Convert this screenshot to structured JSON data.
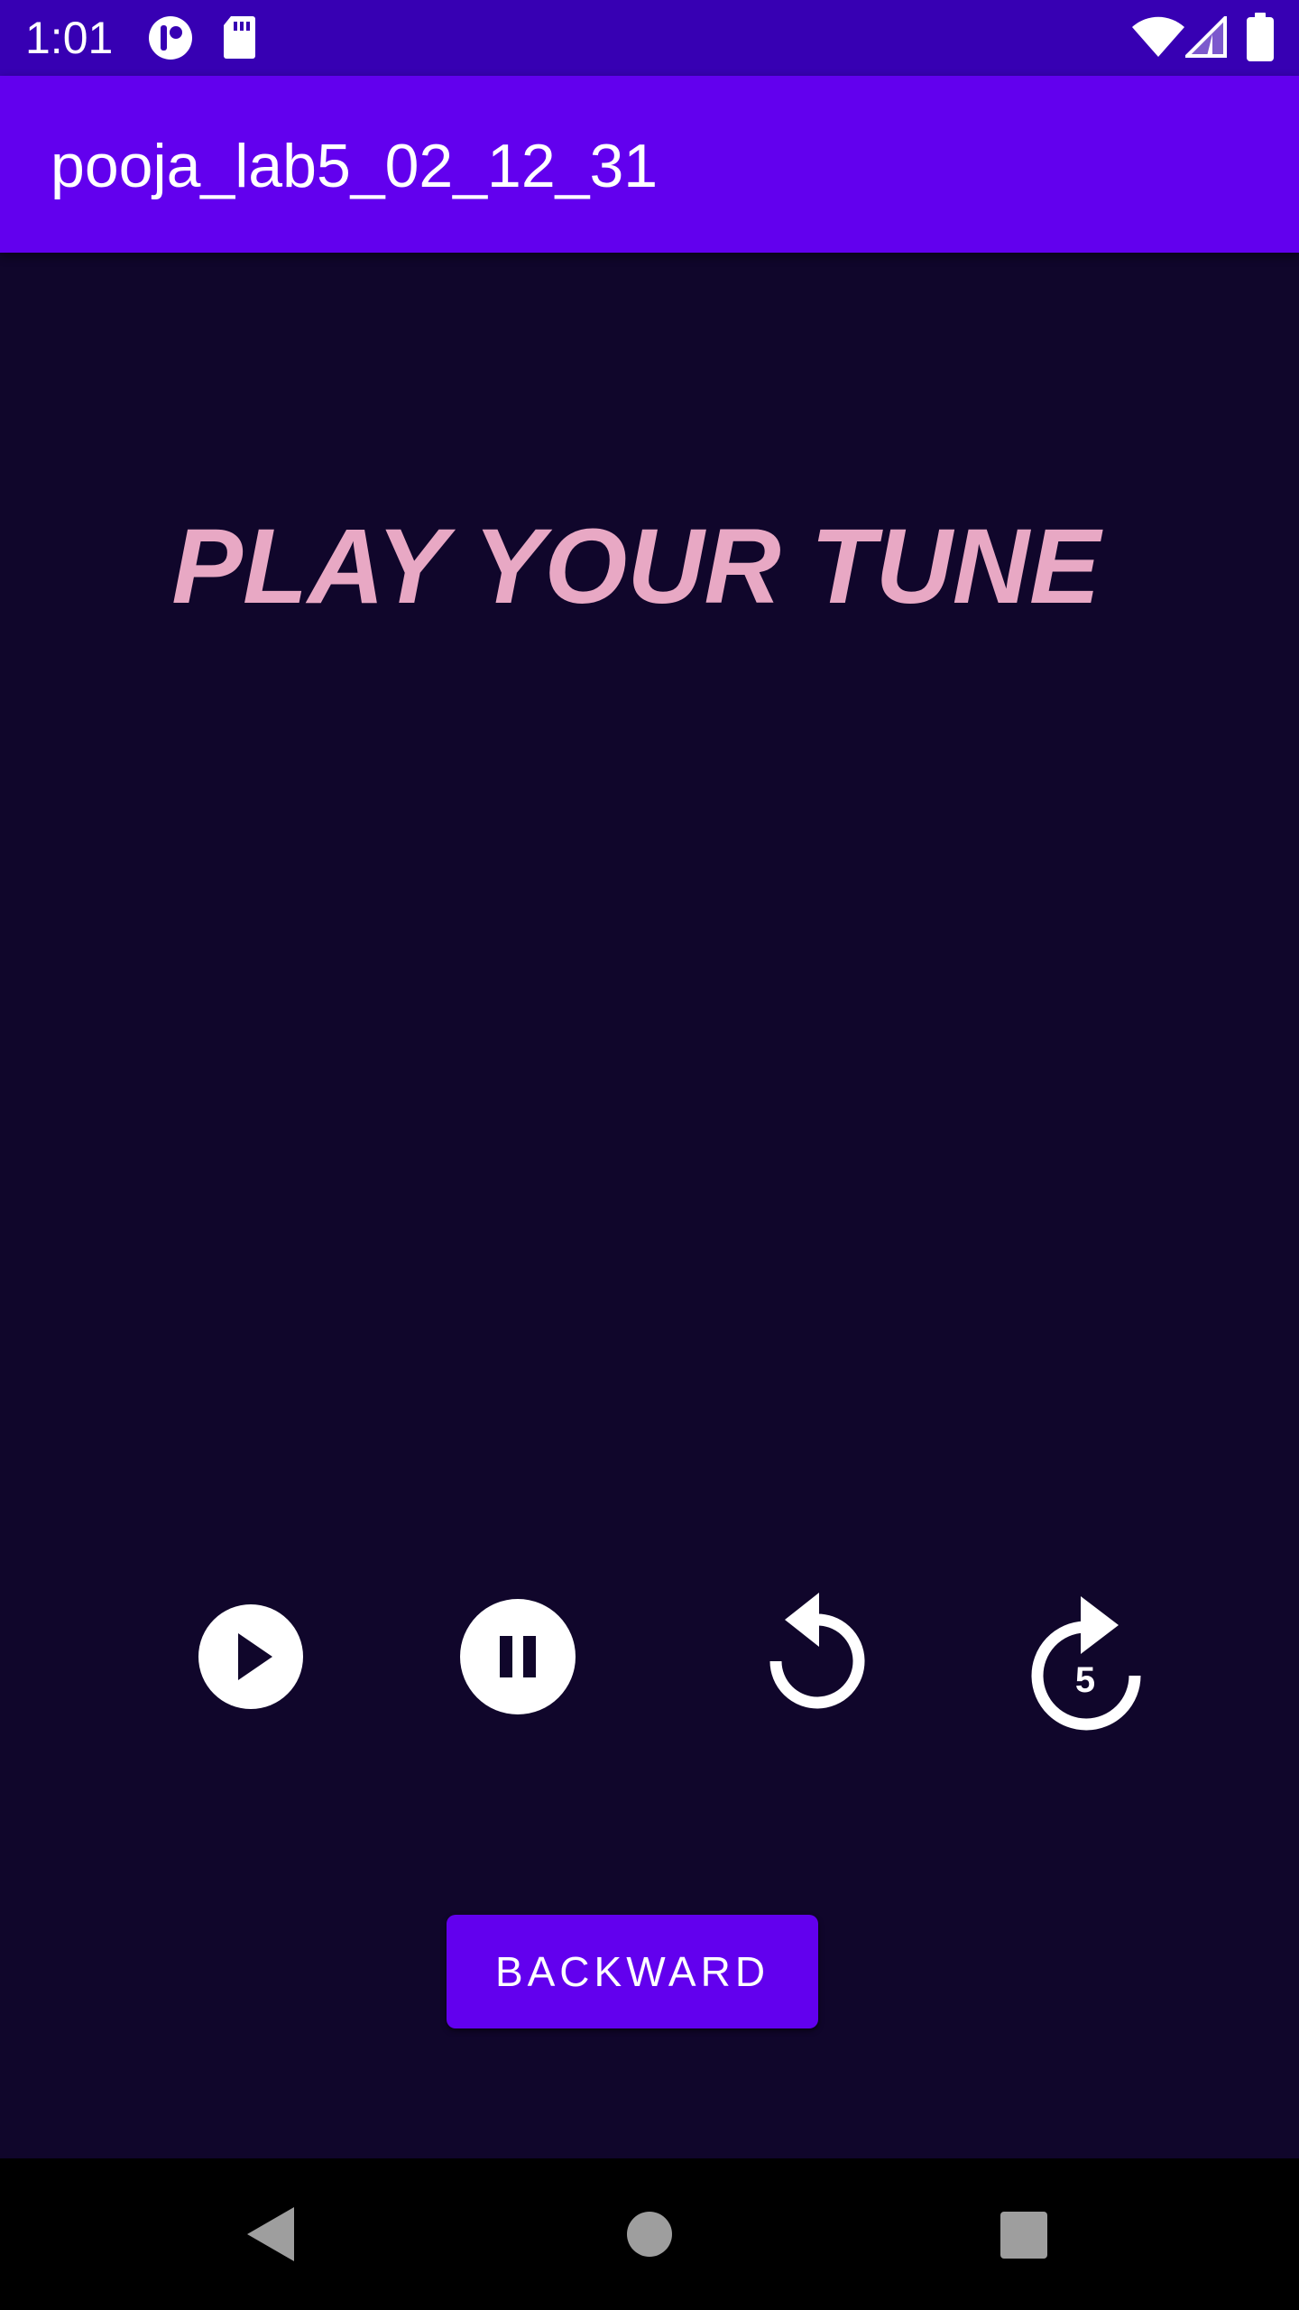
{
  "status_bar": {
    "time": "1:01",
    "icons": [
      "record-icon",
      "sd-card-icon",
      "wifi-icon",
      "signal-icon",
      "battery-icon"
    ]
  },
  "app_bar": {
    "title": "pooja_lab5_02_12_31"
  },
  "main": {
    "headline": "PLAY YOUR TUNE",
    "controls": [
      {
        "icon": "play-circle-icon"
      },
      {
        "icon": "pause-circle-icon"
      },
      {
        "icon": "replay-icon"
      },
      {
        "icon": "forward-5-icon",
        "label": "5"
      }
    ],
    "backward_label": "BACKWARD"
  },
  "nav_bar": {
    "icons": [
      "back-icon",
      "home-icon",
      "recents-icon"
    ]
  },
  "colors": {
    "status_bar": "#3700b3",
    "app_bar": "#6200ee",
    "background": "#10062b",
    "headline": "#e8a8c4",
    "button": "#6200ee",
    "nav_bar": "#000000"
  }
}
